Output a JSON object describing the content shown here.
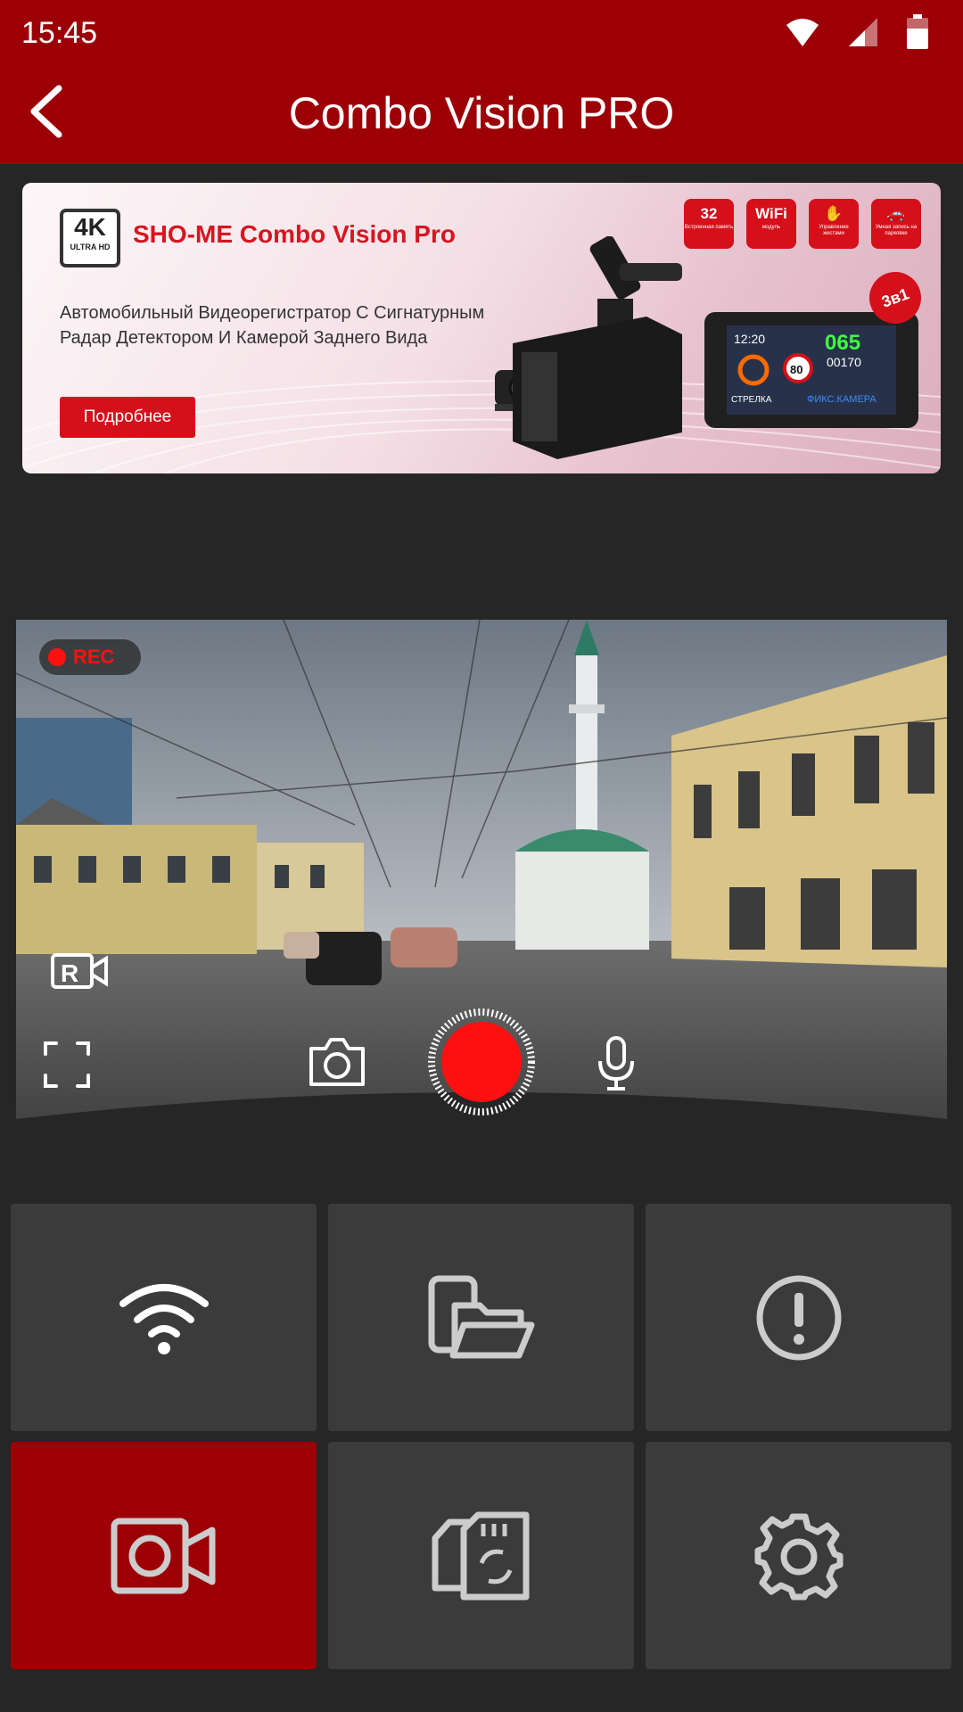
{
  "status": {
    "time": "15:45"
  },
  "appbar": {
    "title": "Combo Vision PRO"
  },
  "banner": {
    "badge_big": "4K",
    "badge_small": "ULTRA HD",
    "title": "SHO-ME Combo Vision Pro",
    "description": "Автомобильный Видеорегистратор С Сигнатурным Радар Детектором И Камерой Заднего Вида",
    "button_label": "Подробнее",
    "features": [
      {
        "main": "32",
        "sub": "Встроенная память"
      },
      {
        "main": "WiFi",
        "sub": "модуль"
      },
      {
        "main": "✋",
        "sub": "Управление жестами"
      },
      {
        "main": "🚗",
        "sub": "Умная запись на парковке"
      }
    ],
    "corner_badge": "3в1",
    "screen_time": "12:20",
    "screen_speed": "065",
    "screen_distance": "00170",
    "screen_limit": "80",
    "screen_label_left": "СТРЕЛКА",
    "screen_label_right": "ФИКС.КАМЕРА"
  },
  "video": {
    "rec_label": "REC"
  },
  "grid": {
    "tiles": [
      {
        "icon": "wifi-icon"
      },
      {
        "icon": "folder-device-icon"
      },
      {
        "icon": "alert-icon"
      },
      {
        "icon": "record-video-icon",
        "active": true
      },
      {
        "icon": "sd-card-sync-icon"
      },
      {
        "icon": "gear-icon"
      }
    ]
  },
  "colors": {
    "primary": "#9c0006",
    "record": "#ff1010",
    "tile": "#3b3b3b",
    "background": "#262626"
  }
}
